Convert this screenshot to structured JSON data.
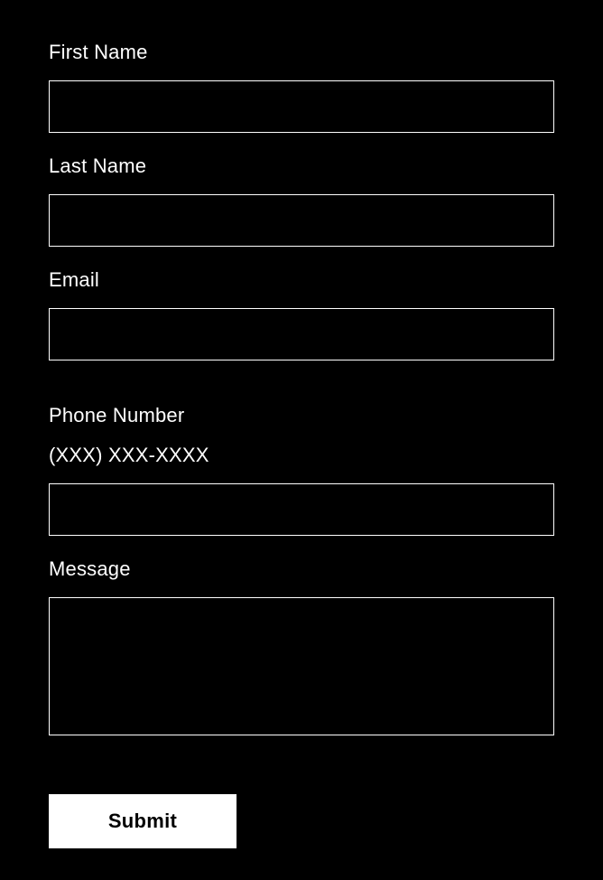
{
  "form": {
    "firstName": {
      "label": "First Name",
      "value": ""
    },
    "lastName": {
      "label": "Last Name",
      "value": ""
    },
    "email": {
      "label": "Email",
      "value": ""
    },
    "phone": {
      "label": "Phone Number",
      "hint": "(XXX) XXX-XXXX",
      "value": ""
    },
    "message": {
      "label": "Message",
      "value": ""
    },
    "submit": {
      "label": "Submit"
    }
  }
}
